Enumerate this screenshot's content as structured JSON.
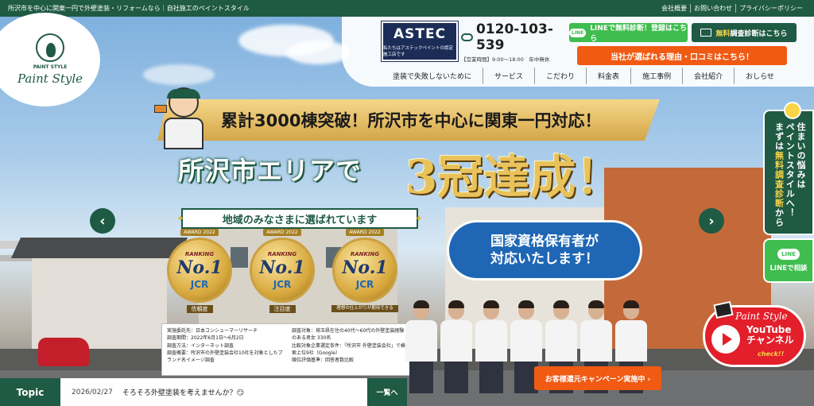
{
  "topbar": {
    "tagline": "所沢市を中心に関東一円で外壁塗装・リフォームなら｜自社施工のペイントスタイル",
    "links": [
      "会社概要",
      "お問い合わせ",
      "プライバシーポリシー"
    ]
  },
  "logo": {
    "mini": "PAINT STYLE",
    "name": "Paint Style"
  },
  "header": {
    "astec_title": "ASTEC",
    "astec_sub": "私たちはアステックペイントの認定施工店です",
    "phone": "0120-103-539",
    "hours": "【営業時間】9:00～18:00　年中無休",
    "line_logo": "LINE",
    "line_btn": "LINEで無料診断！登録はこちら",
    "mail_hl": "無料",
    "mail_btn": "調査診断はこちら",
    "orange_btn": "当社が選ばれる理由・口コミはこちら！"
  },
  "nav": [
    "塗装で失敗しないために",
    "サービス",
    "こだわり",
    "料金表",
    "施工事例",
    "会社紹介",
    "おしらせ"
  ],
  "hero": {
    "ribbon": "累計3000棟突破！所沢市を中心に関東一円対応！",
    "copy": "所沢市エリアで",
    "san": "3冠達成！",
    "sub": "地域のみなさまに選ばれています",
    "qual_line1": "国家資格保有者が",
    "qual_line2": "対応いたします！",
    "prev": "‹",
    "next": "›"
  },
  "medals": [
    {
      "award": "AWARD 2022",
      "rank": "RANKING",
      "no": "No.1",
      "jcr": "JCR",
      "cap": "信頼度"
    },
    {
      "award": "AWARD 2022",
      "rank": "RANKING",
      "no": "No.1",
      "jcr": "JCR",
      "cap": "注目度"
    },
    {
      "award": "AWARD 2022",
      "rank": "RANKING",
      "no": "No.1",
      "jcr": "JCR",
      "cap": "理想の仕上がりが期待できる"
    }
  ],
  "survey": {
    "left": [
      "実施委託先：日本コンシューマーリサーチ",
      "調査期間：2022年6月1日～6月2日",
      "調査方法：インターネット調査",
      "調査概要：所沢市の外壁塗装会社10社を対象としたブランド名イメージ調査"
    ],
    "right": [
      "調査対象：埼玉県在住の40代～60代の外壁塗装経験のある男女 330名",
      "比較対象企業選定条件：「所沢市 外壁塗装会社」で検索上位9社（Google）",
      "順位評価基準：回答者数比較"
    ]
  },
  "side": {
    "consult_1": "住まいの悩みは",
    "consult_2": "ペイントスタイルへ！",
    "consult_3_pre": "まずは",
    "consult_3_hl": "無料調査診断",
    "consult_3_post": "から",
    "line_logo": "LINE",
    "line_label": "LINEで相談"
  },
  "youtube": {
    "title": "Paint Style",
    "brand_1": "YouTube",
    "brand_2": "チャンネル",
    "check": "check!!"
  },
  "campaign": "お客様還元キャンペーン実施中 ›",
  "topic": {
    "label": "Topic",
    "date": "2026/02/27",
    "text": "そろそろ外壁塗装を考えませんか？😏",
    "more": "一覧へ"
  },
  "colors": {
    "brand_green": "#1f5a44",
    "orange": "#f05a13",
    "line_green": "#3fbd4e",
    "gold": "#e8c25a",
    "youtube_red": "#e21f2a"
  }
}
